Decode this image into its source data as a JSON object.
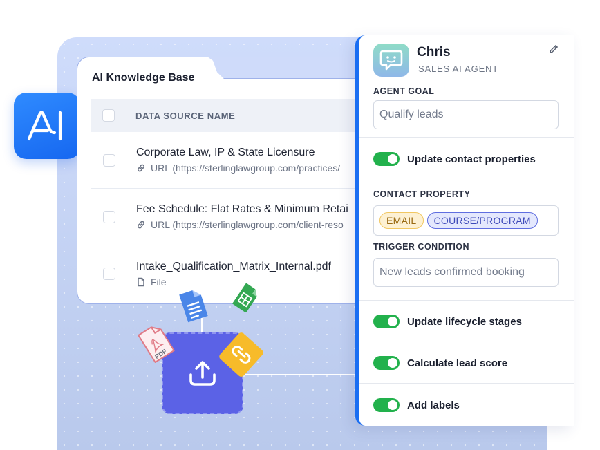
{
  "knowledge_base": {
    "title": "AI Knowledge Base",
    "column_header": "DATA SOURCE NAME",
    "rows": [
      {
        "name": "Corporate Law, IP & State Licensure",
        "type": "URL",
        "detail": "URL (https://sterlinglawgroup.com/practices/",
        "icon": "link-icon"
      },
      {
        "name": "Fee Schedule: Flat Rates & Minimum Retai",
        "type": "URL",
        "detail": "URL (https://sterlinglawgroup.com/client-reso",
        "icon": "link-icon"
      },
      {
        "name": "Intake_Qualification_Matrix_Internal.pdf",
        "type": "File",
        "detail": "File",
        "icon": "file-icon"
      }
    ]
  },
  "ai_badge": {
    "label": "AI",
    "color": "#1a6ef2"
  },
  "upload": {
    "icon": "upload-icon",
    "color": "#5b62e6"
  },
  "floating_files": [
    {
      "icon": "pdf-file-icon",
      "label": "PDF"
    },
    {
      "icon": "google-docs-icon"
    },
    {
      "icon": "google-sheets-icon"
    },
    {
      "icon": "link-file-icon"
    }
  ],
  "agent": {
    "name": "Chris",
    "role": "SALES AI AGENT",
    "goal_label": "AGENT GOAL",
    "goal_value": "Qualify leads",
    "toggles": [
      {
        "label": "Update contact properties",
        "enabled": true
      },
      {
        "label": "Update lifecycle stages",
        "enabled": true
      },
      {
        "label": "Calculate lead score",
        "enabled": true
      },
      {
        "label": "Add labels",
        "enabled": true
      }
    ],
    "contact_property_label": "CONTACT PROPERTY",
    "contact_property_chips": [
      "EMAIL",
      "COURSE/PROGRAM"
    ],
    "trigger_label": "TRIGGER CONDITION",
    "trigger_placeholder": "New leads confirmed booking",
    "accent_color": "#1a6ef2",
    "toggle_color": "#22b14c"
  }
}
